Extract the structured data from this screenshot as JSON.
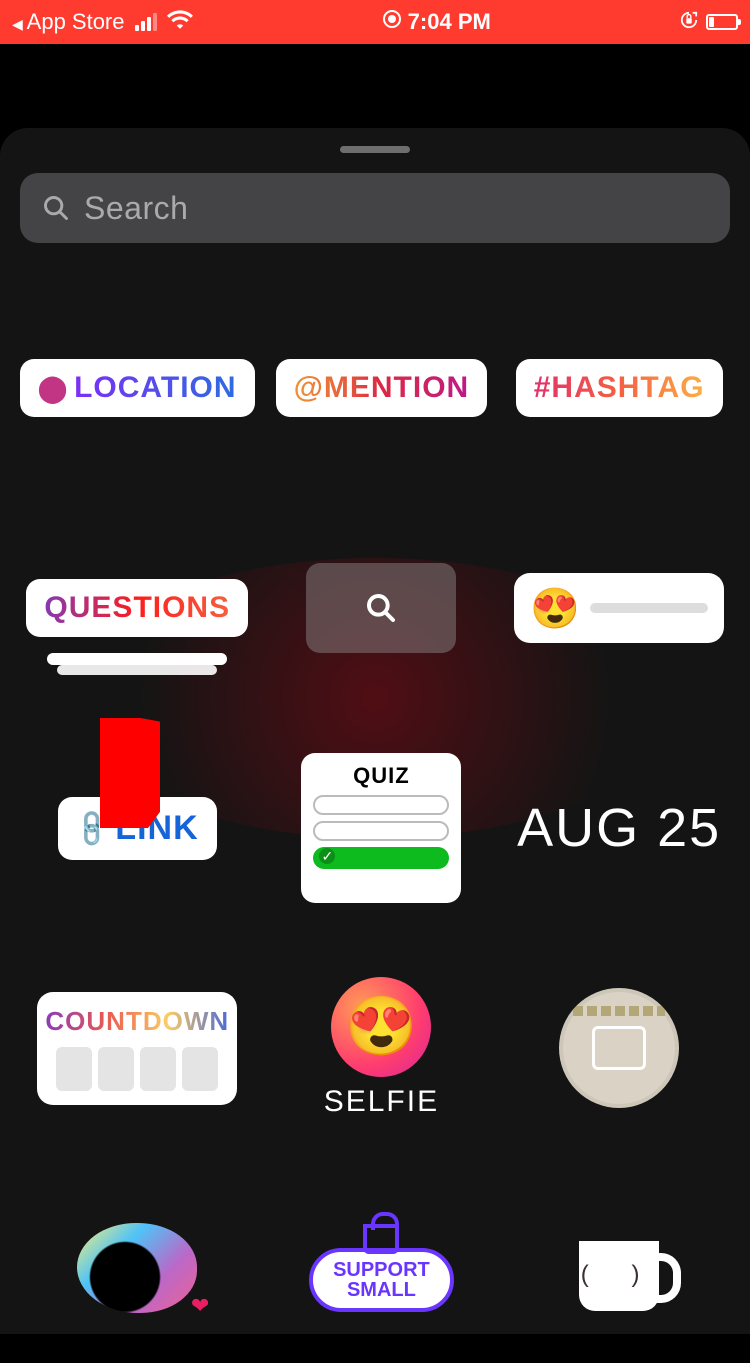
{
  "status": {
    "back_app": "App Store",
    "time": "7:04 PM",
    "recording": true
  },
  "search": {
    "placeholder": "Search"
  },
  "stickers": {
    "location": "LOCATION",
    "mention": "@MENTION",
    "hashtag": "#HASHTAG",
    "questions": "QUESTIONS",
    "slider_emoji": "😍",
    "link": "LINK",
    "quiz": "QUIZ",
    "date": "AUG 25",
    "countdown": "COUNTDOWN",
    "selfie": "SELFIE",
    "support_small": "SUPPORT\nSMALL"
  }
}
